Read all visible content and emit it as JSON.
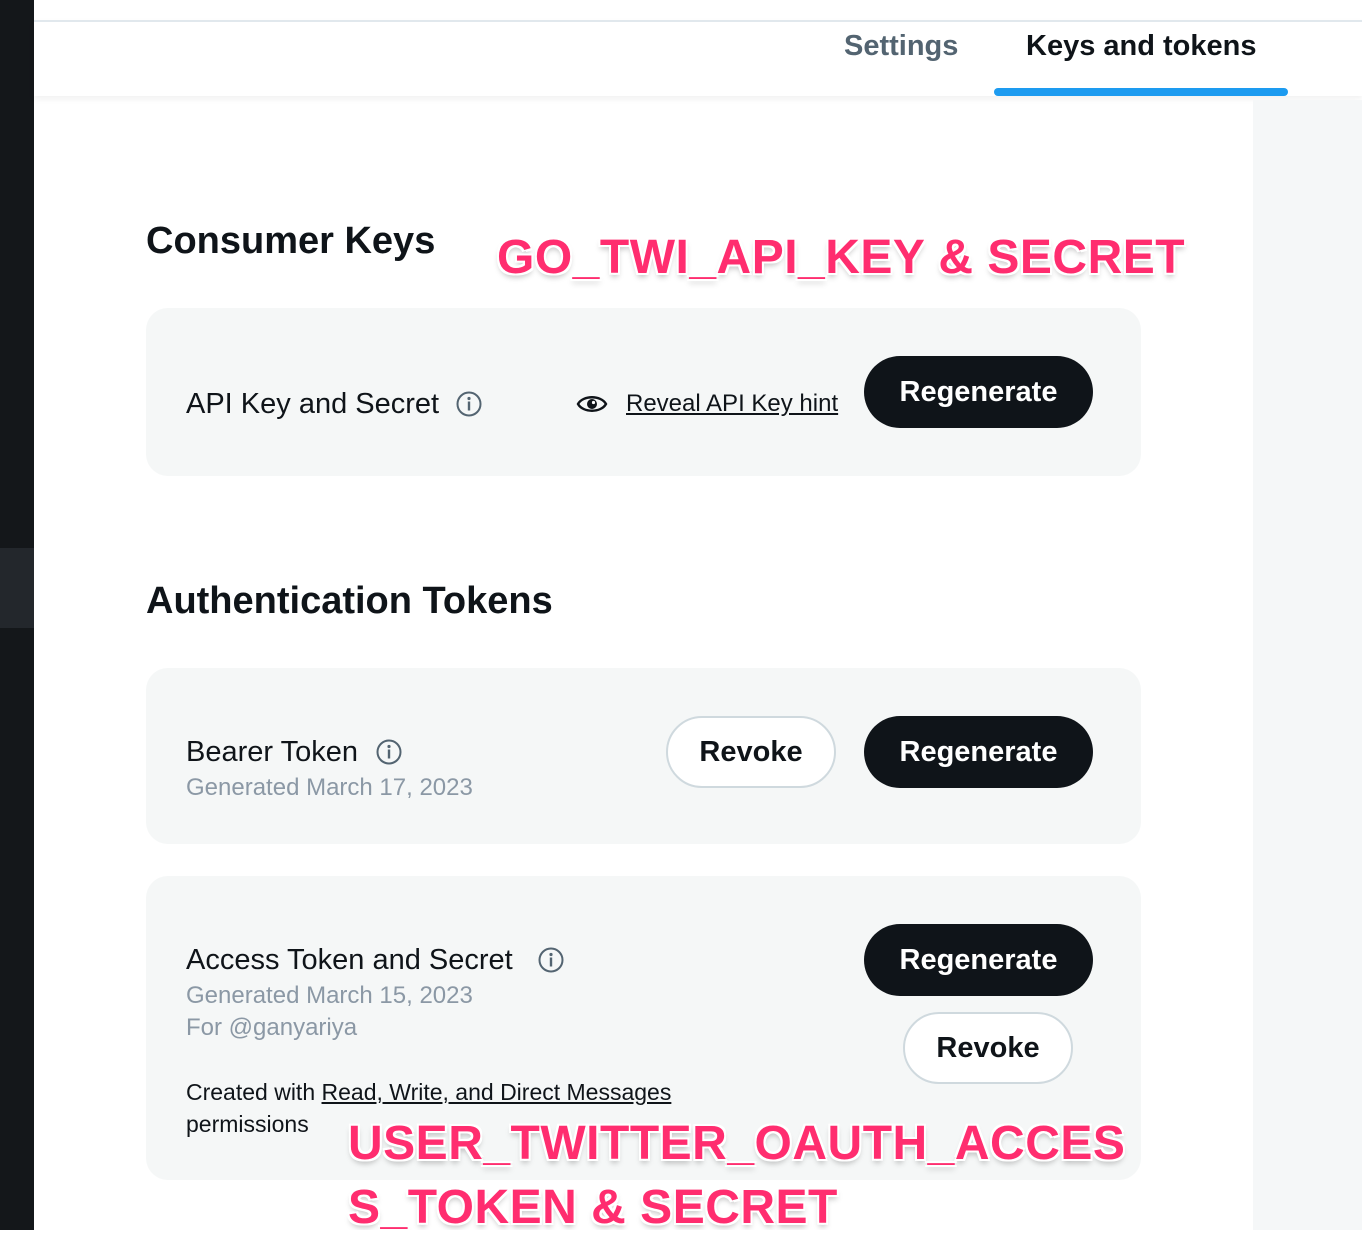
{
  "tabs": {
    "settings": "Settings",
    "keys_and_tokens": "Keys and tokens"
  },
  "consumer_keys": {
    "title": "Consumer Keys",
    "annotation": "GO_TWI_API_KEY & SECRET",
    "api_key": {
      "label": "API Key and Secret",
      "reveal_link": "Reveal API Key hint",
      "regenerate": "Regenerate"
    }
  },
  "auth_tokens": {
    "title": "Authentication Tokens",
    "bearer": {
      "label": "Bearer Token",
      "generated": "Generated March 17, 2023",
      "revoke": "Revoke",
      "regenerate": "Regenerate"
    },
    "access": {
      "label": "Access Token and Secret",
      "generated": "Generated March 15, 2023",
      "for_user": "For @ganyariya",
      "created_prefix": "Created with ",
      "permissions_link": "Read, Write, and Direct Messages",
      "created_suffix": "permissions",
      "regenerate": "Regenerate",
      "revoke": "Revoke"
    },
    "annotation_line1": "USER_TWITTER_OAUTH_ACCES",
    "annotation_line2": "S_TOKEN & SECRET"
  },
  "icons": {
    "info": "info-icon",
    "eye": "eye-icon"
  },
  "colors": {
    "accent": "#1d9bf0",
    "annotation": "#ff2d6f",
    "button_dark": "#0f1419",
    "meta_text": "#8b98a5"
  }
}
